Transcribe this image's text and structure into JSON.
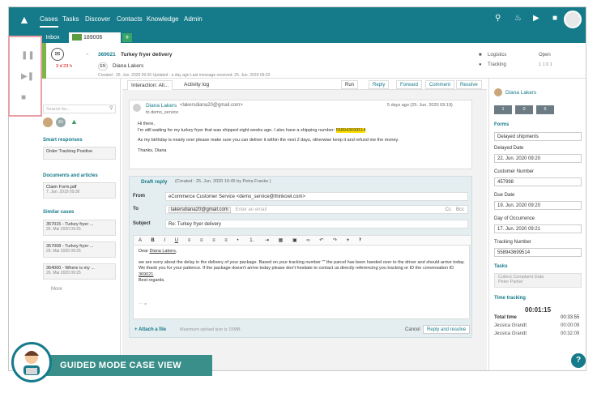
{
  "nav": {
    "items": [
      "Cases",
      "Tasks",
      "Discover",
      "Contacts",
      "Knowledge",
      "Admin"
    ]
  },
  "tabs": {
    "inbox": "Inbox",
    "case": "189006"
  },
  "case": {
    "id": "369021",
    "subject": "Turkey fryer delivery",
    "lang": "EN",
    "customer": "Diana Lakers",
    "sla": "3 d 23 h",
    "meta": "Created : 25. Jun. 2020 09:20   Updated : a day ago   Last message received: 25. Jun. 2020 09:20",
    "category": "Logistics",
    "status": "Open",
    "sub_category": "Tracking",
    "counts": "1  1  0  1"
  },
  "left": {
    "search_placeholder": "Search for...",
    "avatar_initials": "JG",
    "smart_title": "Smart responses",
    "smart_items": [
      "Order Tracking Positive"
    ],
    "docs_title": "Documents and articles",
    "doc_name": "Claim Form.pdf",
    "doc_date": "7. Jan. 2019 09:30",
    "similar_title": "Similar cases",
    "similar": [
      {
        "title": "357015 - Turkey fryer ...",
        "date": "26. Mai 2020 09:25"
      },
      {
        "title": "357008 - Turkey fryer ...",
        "date": "26. Mai 2020 09:25"
      },
      {
        "title": "364000 - Where is my ...",
        "date": "26. Mai 2020 09:25"
      }
    ],
    "more": "More"
  },
  "center": {
    "tab_interaction": "Interaction: All...",
    "tab_activity": "Activity log",
    "btn_run": "Run",
    "btn_reply": "Reply",
    "btn_forward": "Forward",
    "btn_comment": "Comment",
    "btn_resolve": "Resolve",
    "mail": {
      "from": "Diana Lakers",
      "email": "<lakersdiana20@gmail.com>",
      "to": "to demo_service",
      "time": "5 days ago (25. Jun. 2020 09:19)",
      "greeting": "Hi there,",
      "line1": "I'm still waiting for my turkey fryer that was shipped eight weeks ago. I also have a shipping number:",
      "tracking": "558943699514",
      "line2": "As my birthday is nearly over please make sure you can deliver it within the next 2 days, otherwise keep it and refund me the money.",
      "closing": "Thanks, Diana"
    },
    "draft": {
      "title": "Draft reply",
      "meta": "(Created : 25. Jun. 2020 16:45 by Petra Franke )",
      "from_label": "From",
      "from_value": "eCommerce Customer Service <demo_service@thinkowl.com>",
      "to_label": "To",
      "to_chip": "lakersdiana20@gmail.com",
      "to_placeholder": "Enter an email",
      "cc": "Cc",
      "bcc": "Bcc",
      "subject_label": "Subject",
      "subject_value": "Re: Turkey fryer delivery",
      "body_greeting": "Dear",
      "body_name": "Diana Lakers",
      "body_p1a": "we are sorry about the delay in the delivery of your package. Based on your tracking number \"\" the parcel has been handed over to the driver and should arrive today. We thank you for your patience. If the package doesn't arrive today please don't hesitate to contact us directly referencing you tracking or ID the conversation ID",
      "body_case": "369021",
      "body_regards": "Best regards,",
      "attach": "Attach a file",
      "upload_note": "Maximum upload size is 15MB.",
      "cancel": "Cancel",
      "reply_resolve": "Reply and resolve"
    }
  },
  "right": {
    "contact": "Diana Lakers",
    "chips": [
      "1",
      "0",
      "6"
    ],
    "forms_title": "Forms",
    "form_select": "Delayed shipments",
    "delayed_date_label": "Delayed Date",
    "delayed_date": "22. Jun. 2020 09:20",
    "customer_number_label": "Customer Number",
    "customer_number": "457998",
    "due_date_label": "Due Date",
    "due_date": "19. Jun. 2020 09:20",
    "occurrence_label": "Day of Occurrence",
    "occurrence": "17. Jun. 2020 09:21",
    "tracking_label": "Tracking Number",
    "tracking": "558943699514",
    "tasks_title": "Tasks",
    "task_name": "Collect Complaint Data",
    "task_user": "Peter Parker",
    "time_title": "Time tracking",
    "timer": "00:01:15",
    "total_label": "Total time",
    "total": "00:33:55",
    "entries": [
      {
        "name": "Jessica Grandt",
        "time": "00:00:09"
      },
      {
        "name": "Jessica Grandt",
        "time": "00:32:09"
      }
    ]
  },
  "badge": {
    "label": "GUIDED MODE CASE VIEW"
  },
  "help": "?"
}
